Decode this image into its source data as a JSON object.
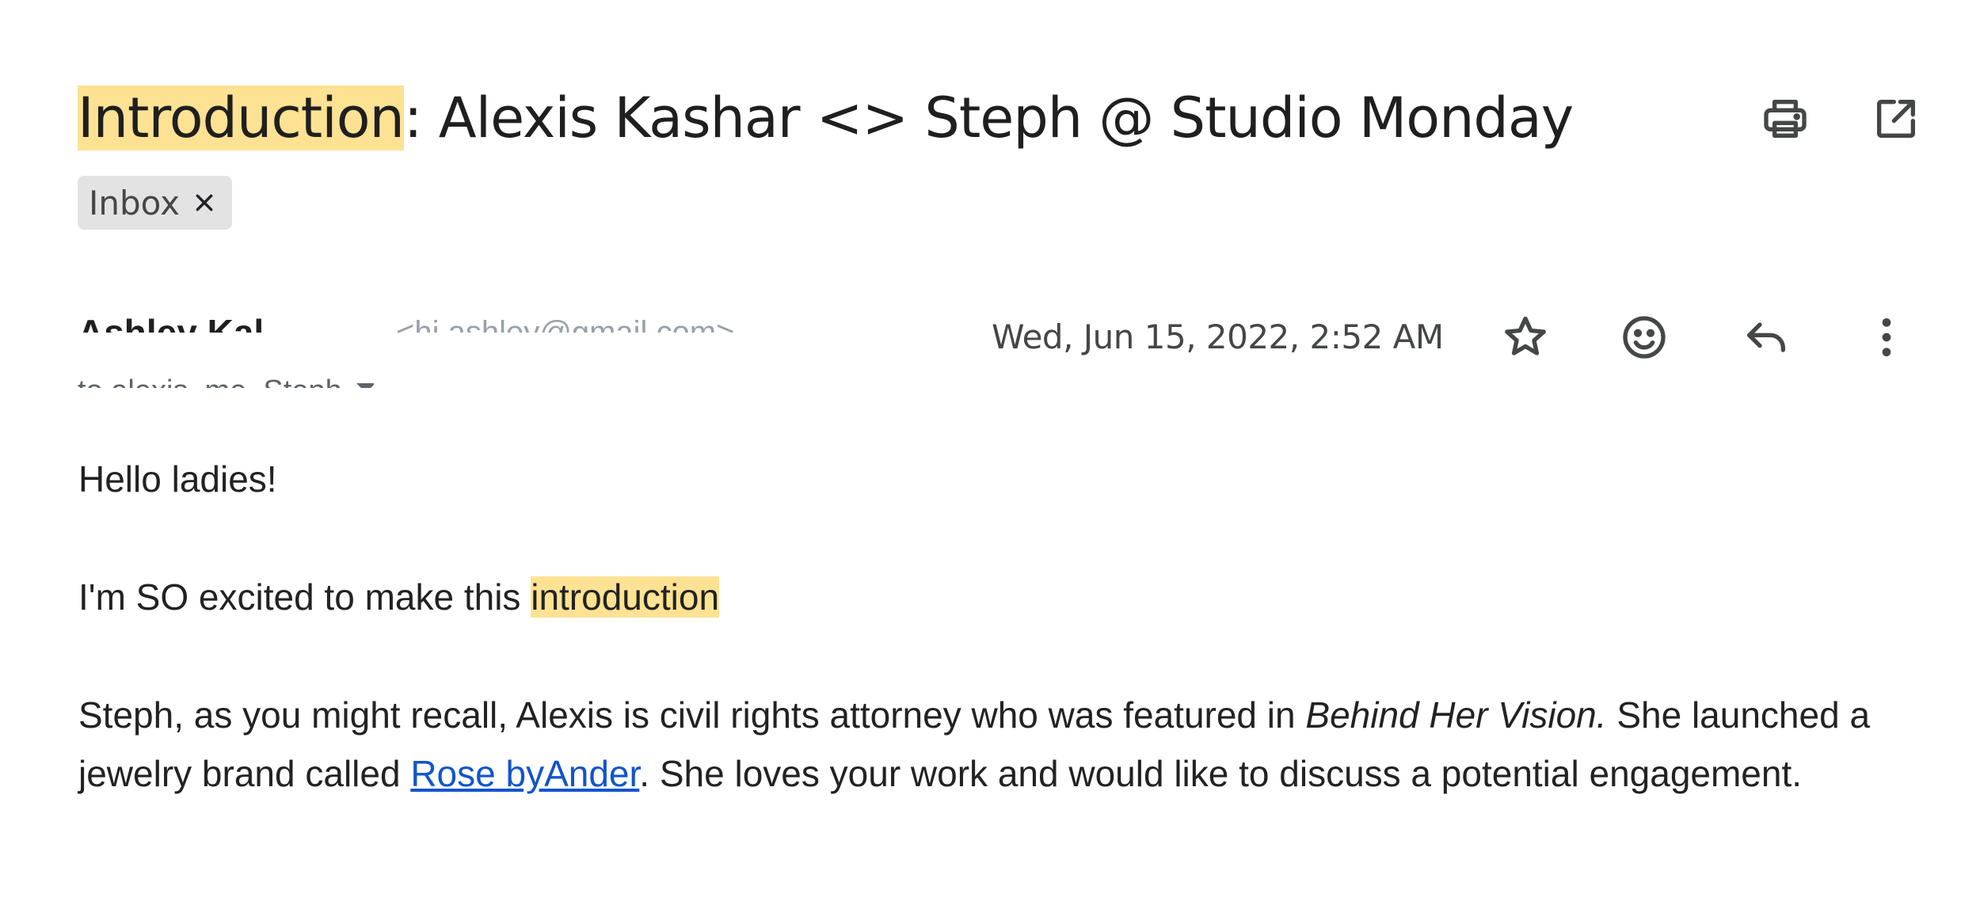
{
  "subject": {
    "highlighted": "Introduction",
    "rest": ": Alexis Kashar <> Steph @ Studio Monday"
  },
  "header_actions": [
    {
      "name": "print-all-icon"
    },
    {
      "name": "open-in-new-window-icon"
    }
  ],
  "label_chip": {
    "text": "Inbox",
    "remove_icon": "close-icon"
  },
  "message": {
    "sender_name": "Ashley Kal...",
    "sender_email": "<hi.ashley@gmail.com>",
    "recipients": "to alexis, me, Steph",
    "date": "Wed, Jun 15, 2022, 2:52 AM",
    "actions": [
      {
        "name": "star-icon"
      },
      {
        "name": "add-reaction-icon"
      },
      {
        "name": "reply-icon"
      },
      {
        "name": "more-options-icon"
      }
    ]
  },
  "body": {
    "greeting": "Hello ladies!",
    "line2_before": "I'm SO excited to make this ",
    "line2_highlight": "introduction",
    "para3_part1": "Steph, as you might recall, Alexis is civil rights attorney who was featured in ",
    "para3_italic": "Behind Her Vision.",
    "para3_part2": " She launched a jewelry brand called ",
    "para3_link": "Rose byAnder",
    "para3_part3": ". She loves your work and would like to discuss a potential engagement."
  },
  "colors": {
    "highlight": "#fde293",
    "link": "#1155cc",
    "chip_bg": "#e3e3e3",
    "text": "#202124",
    "icon": "#444746"
  }
}
